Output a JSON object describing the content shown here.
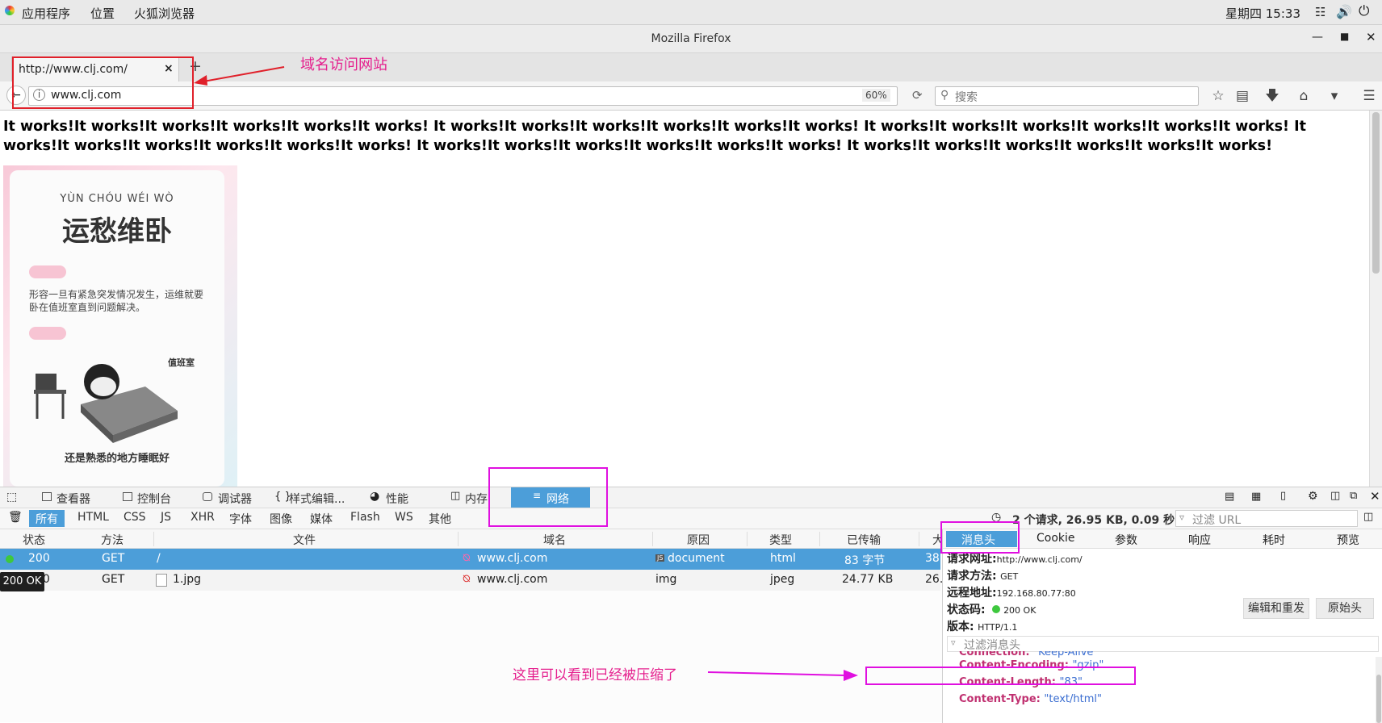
{
  "system_bar": {
    "menus": [
      "应用程序",
      "位置",
      "火狐浏览器"
    ],
    "clock": "星期四 15:33"
  },
  "window": {
    "title": "Mozilla Firefox"
  },
  "tab": {
    "title": "http://www.clj.com/",
    "close": "×",
    "new_tab": "+"
  },
  "urlbar": {
    "url": "www.clj.com",
    "zoom": "60%"
  },
  "search": {
    "placeholder": "搜索"
  },
  "page": {
    "works_text": "It works!It works!It works!It works!It works!It works! It works!It works!It works!It works!It works!It works! It works!It works!It works!It works!It works!It works! It works!It works!It works!It works!It works!It works! It works!It works!It works!It works!It works!It works! It works!It works!It works!It works!It works!It works!",
    "poster": {
      "pinyin": "YÙN CHÓU WÉI WÒ",
      "title": "运愁维卧",
      "desc": "形容一旦有紧急突发情况发生，运维就要卧在值班室直到问题解决。",
      "sign": "值班室",
      "caption": "还是熟悉的地方睡眠好"
    }
  },
  "annotations": {
    "domain_note": "域名访问网站",
    "compress_note": "这里可以看到已经被压缩了"
  },
  "devtools": {
    "tabs": [
      "查看器",
      "控制台",
      "调试器",
      "样式编辑...",
      "性能",
      "内存",
      "网络"
    ],
    "active_tab": "网络",
    "filters": [
      "所有",
      "HTML",
      "CSS",
      "JS",
      "XHR",
      "字体",
      "图像",
      "媒体",
      "Flash",
      "WS",
      "其他"
    ],
    "summary": "2 个请求, 26.95 KB, 0.09 秒",
    "filter_url_placeholder": "过滤 URL",
    "columns": [
      "状态",
      "方法",
      "文件",
      "域名",
      "原因",
      "类型",
      "已传输",
      "大"
    ],
    "rows": [
      {
        "status": "200",
        "method": "GET",
        "file": "/",
        "domain": "www.clj.com",
        "cause": "document",
        "type": "html",
        "transferred": "83 字节",
        "size": "38"
      },
      {
        "status": "200",
        "method": "GET",
        "file": "1.jpg",
        "domain": "www.clj.com",
        "cause": "img",
        "type": "jpeg",
        "transferred": "24.77 KB",
        "size": "26."
      }
    ],
    "tooltip": "200 OK",
    "detail_tabs": [
      "消息头",
      "Cookie",
      "参数",
      "响应",
      "耗时",
      "预览"
    ],
    "request": {
      "url_label": "请求网址:",
      "url": "http://www.clj.com/",
      "method_label": "请求方法:",
      "method": "GET",
      "remote_label": "远程地址:",
      "remote": "192.168.80.77:80",
      "status_label": "状态码:",
      "status": "200  OK",
      "version_label": "版本:",
      "version": "HTTP/1.1"
    },
    "edit_resend": "编辑和重发",
    "raw_headers": "原始头",
    "filter_headers_placeholder": "过滤消息头",
    "headers": [
      {
        "name": "Connection:",
        "value": "\"Keep-Alive\""
      },
      {
        "name": "Content-Encoding:",
        "value": "\"gzip\""
      },
      {
        "name": "Content-Length:",
        "value": "\"83\""
      },
      {
        "name": "Content-Type:",
        "value": "\"text/html\""
      }
    ]
  },
  "colors": {
    "accent": "#4c9ed9",
    "annotation": "#e5208e",
    "highlight_red": "#e0202a"
  }
}
